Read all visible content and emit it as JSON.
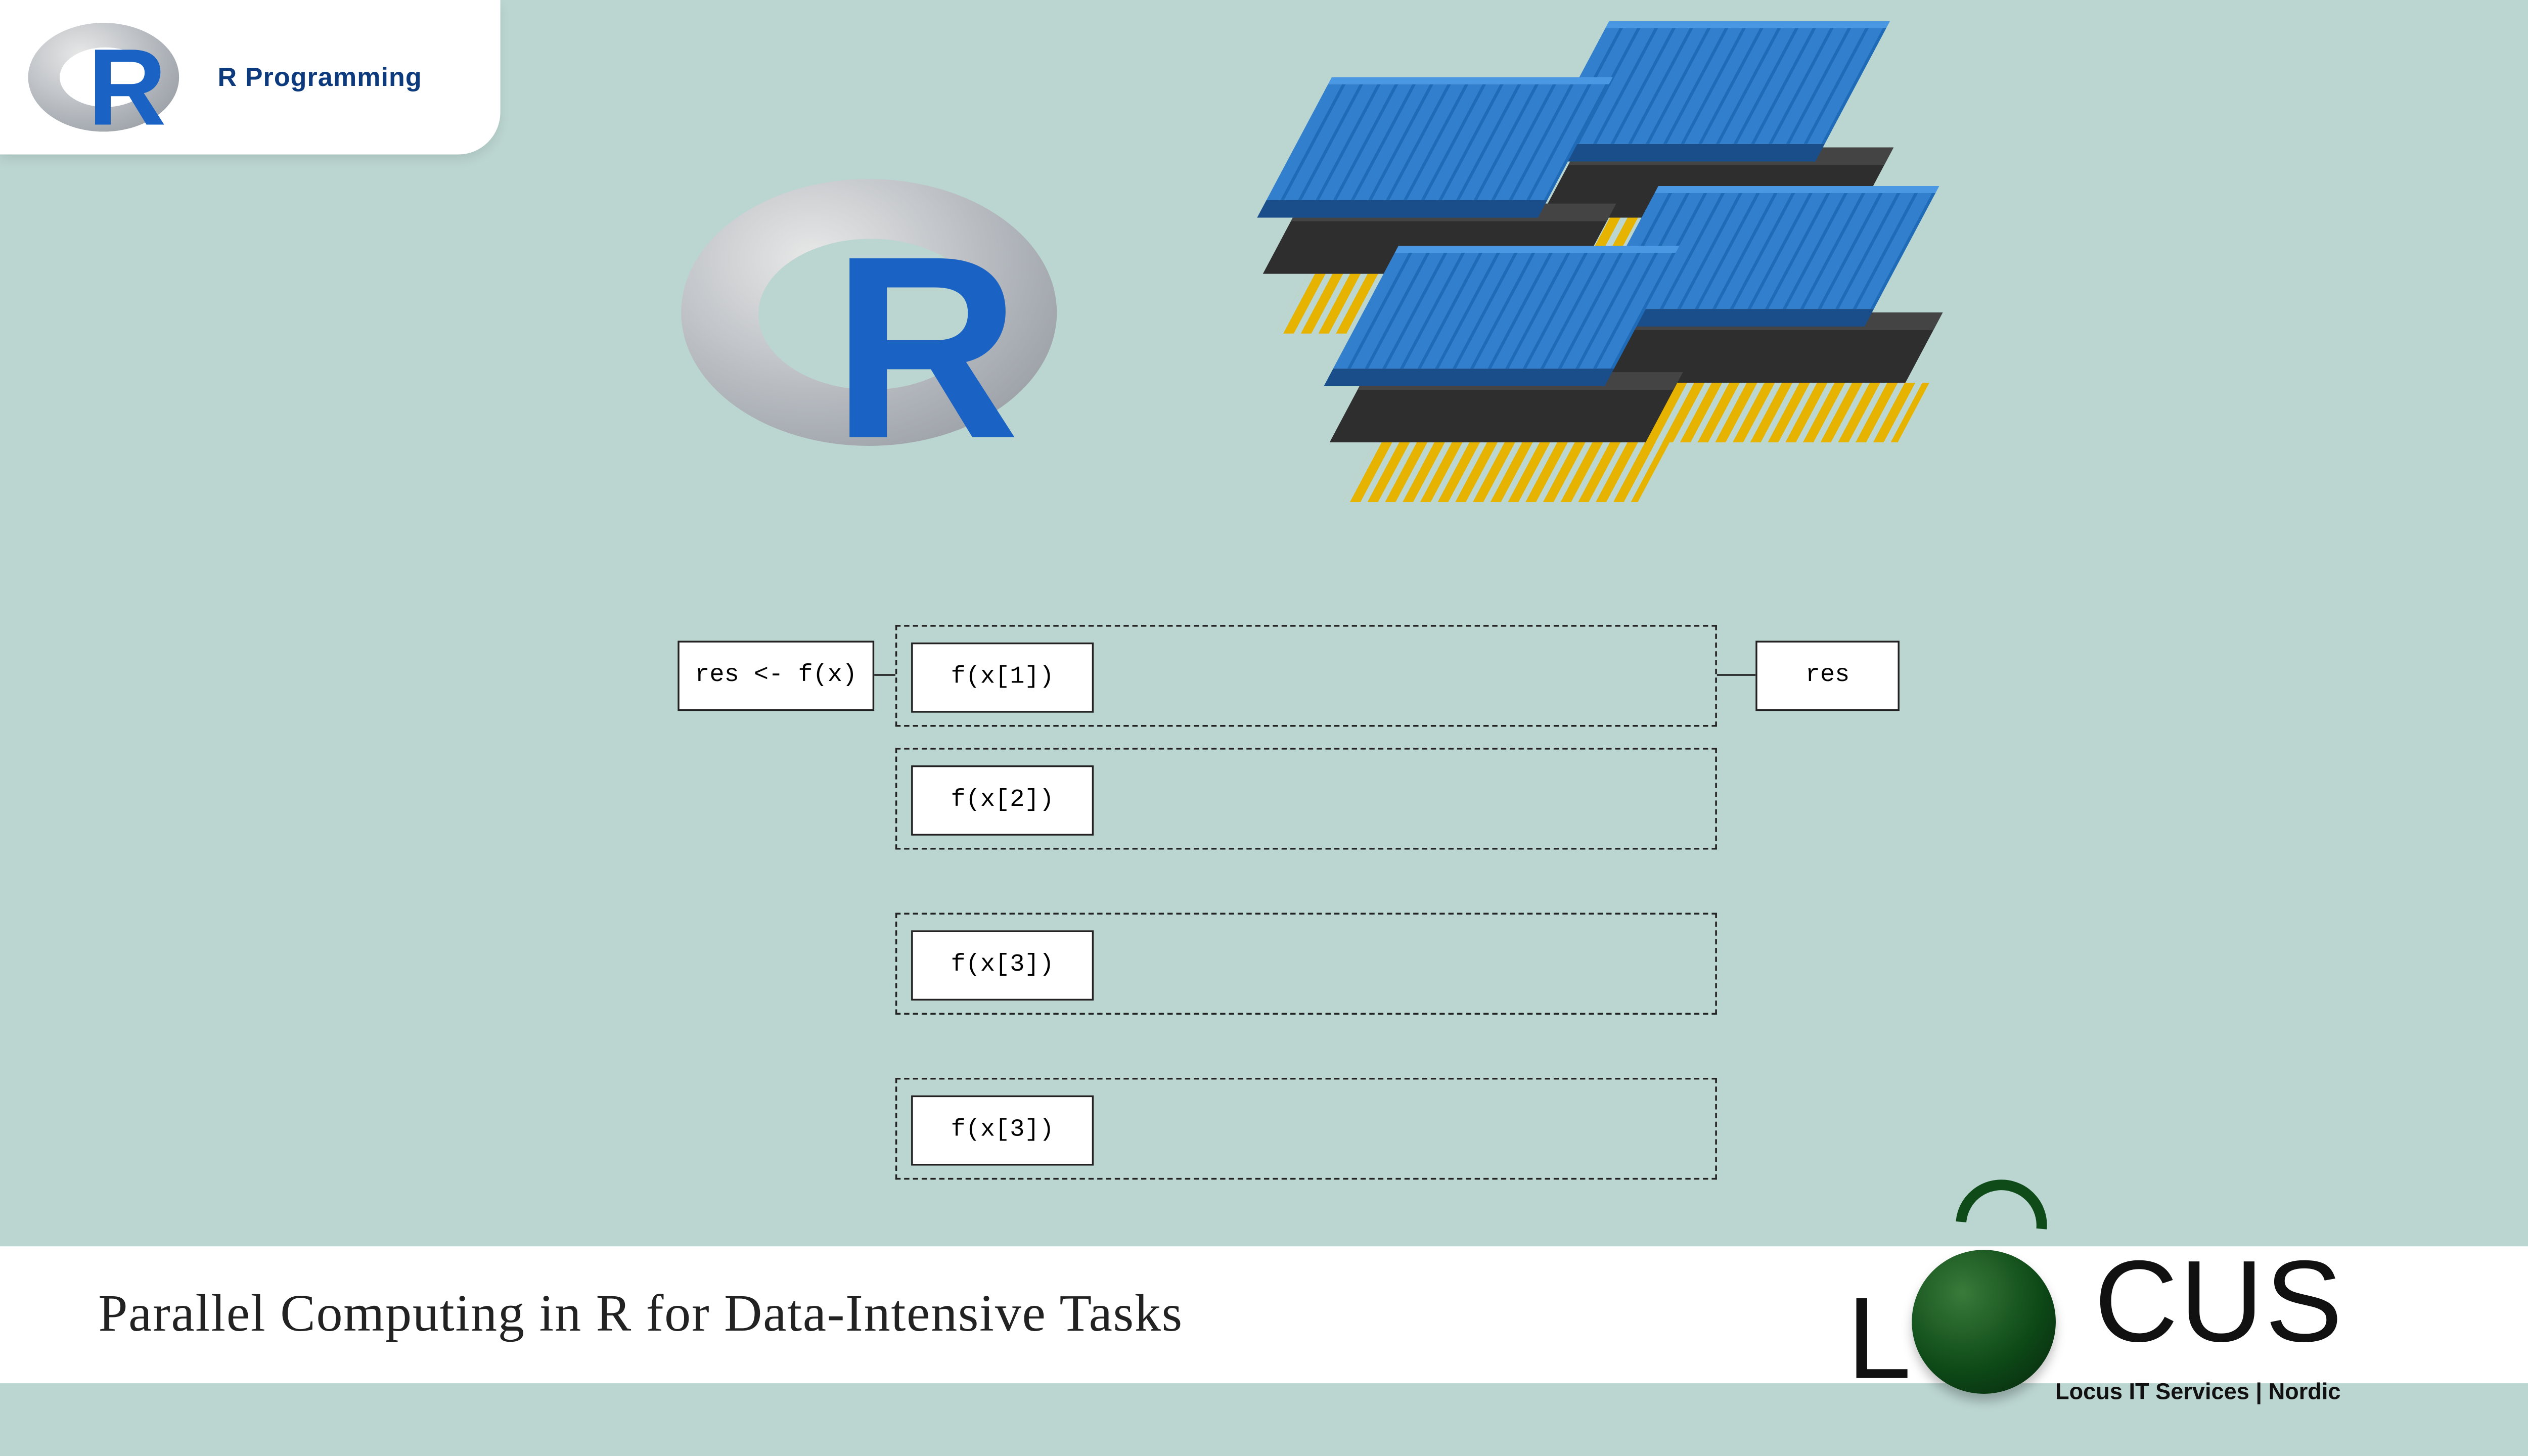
{
  "badge": {
    "label": "R Programming"
  },
  "hero": {
    "r_letter": "R",
    "cpu_count": 4
  },
  "diagram": {
    "input": "res <- f(x)",
    "output": "res",
    "lanes": [
      "f(x[1])",
      "f(x[2])",
      "f(x[3])",
      "f(x[3])"
    ]
  },
  "title": "Parallel Computing in R for Data-Intensive Tasks",
  "footer_logo": {
    "word_before_sphere": "L",
    "word_after_sphere": "CUS",
    "subline": "Locus IT Services | Nordic"
  },
  "colors": {
    "background": "#bbd5d0",
    "r_blue": "#1a62c3",
    "heatsink_blue": "#327fce",
    "pin_gold": "#e6b400"
  }
}
